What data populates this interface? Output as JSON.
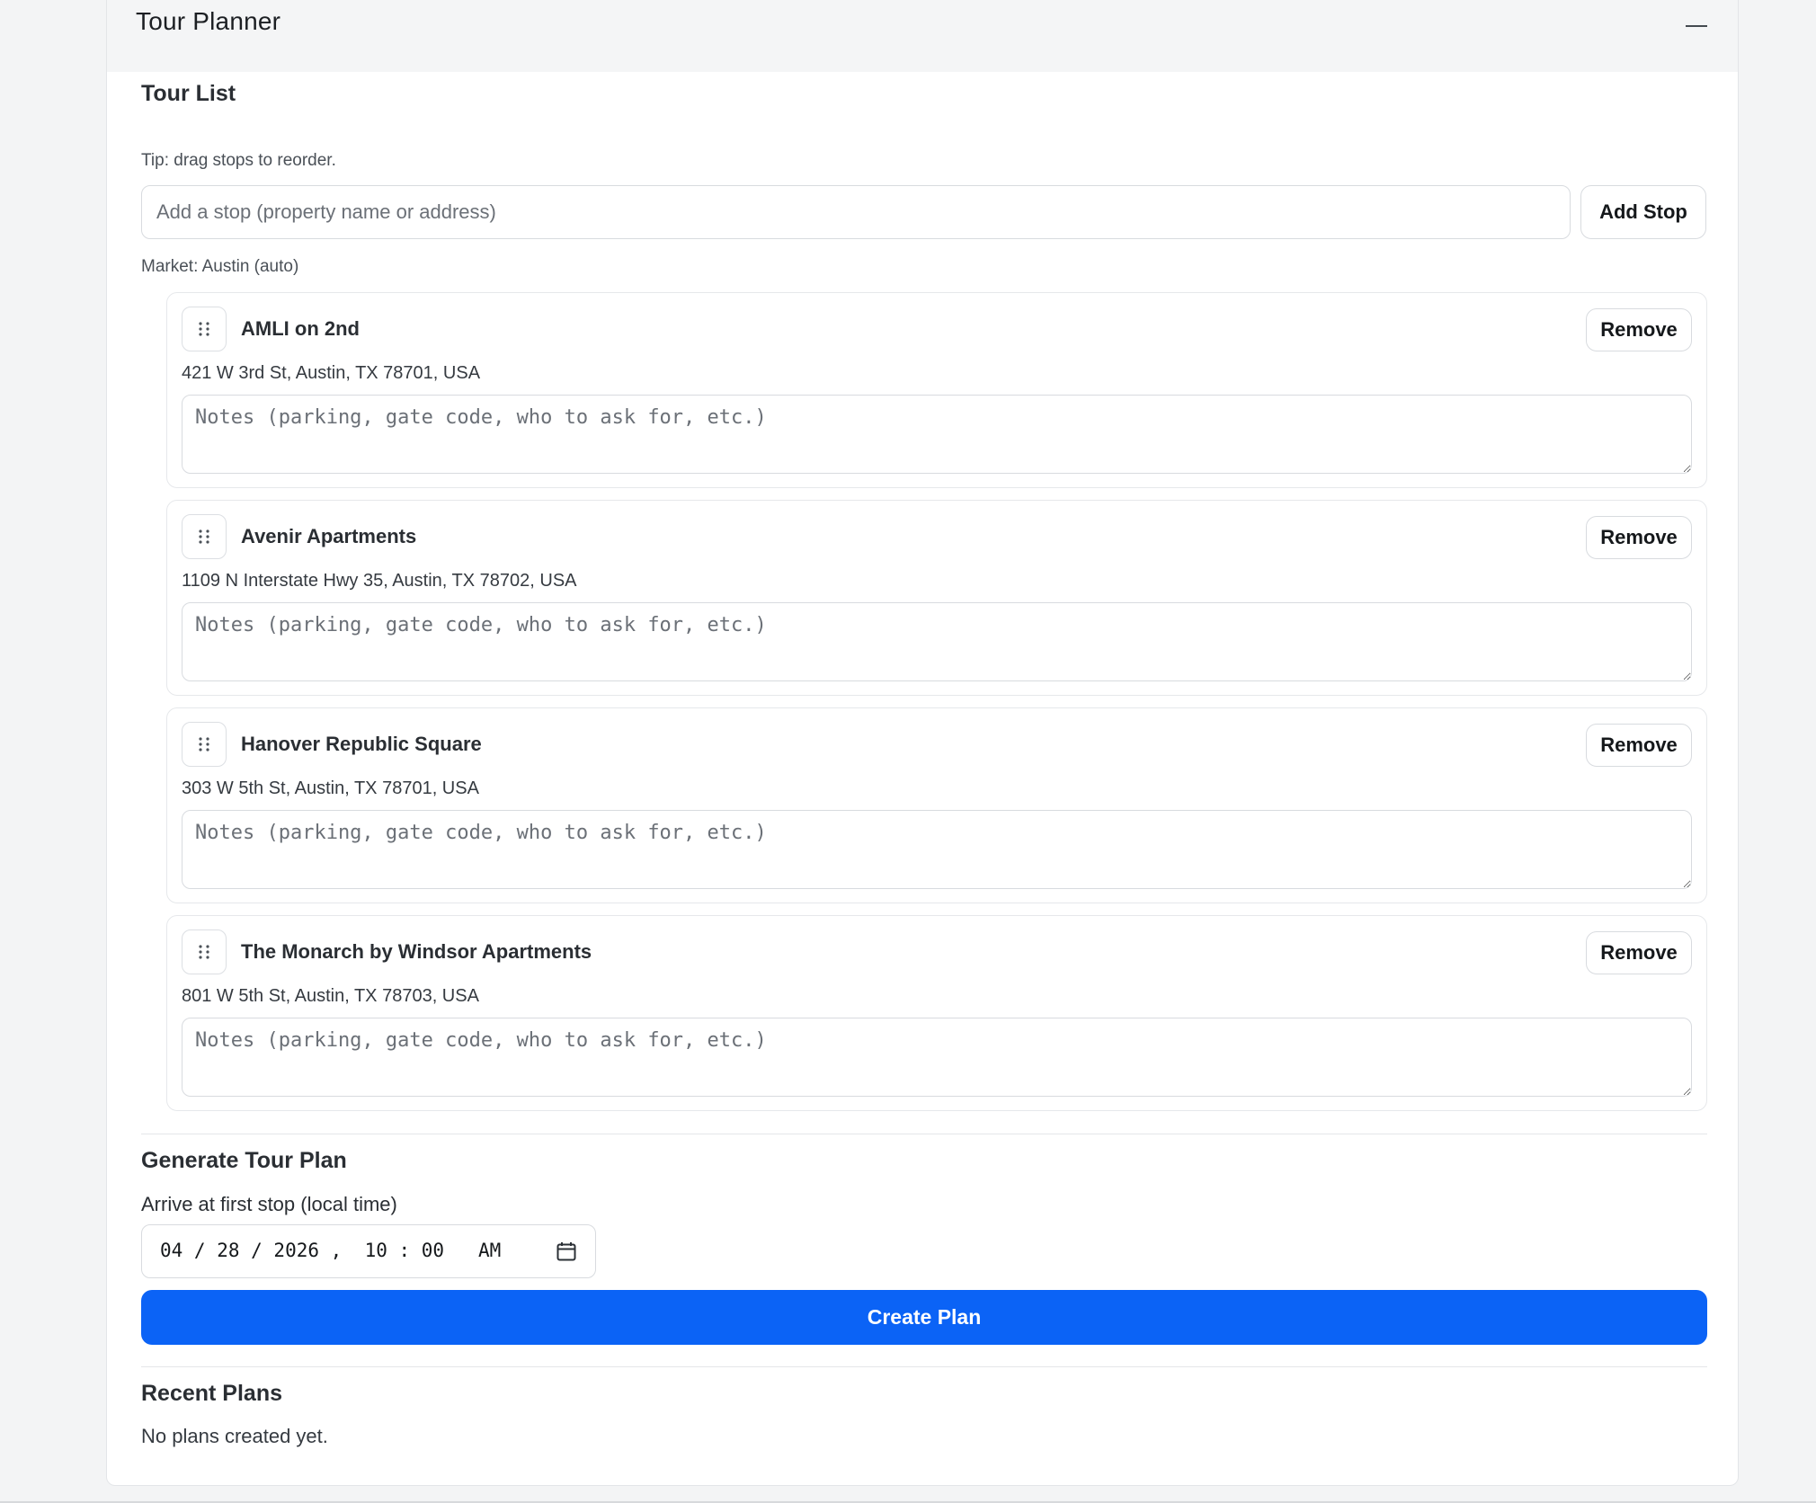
{
  "panel": {
    "title": "Tour Planner",
    "collapse_icon": "minus-icon"
  },
  "tour_list": {
    "heading": "Tour List",
    "tip": "Tip: drag stops to reorder.",
    "add_stop": {
      "placeholder": "Add a stop (property name or address)",
      "value": "",
      "button_label": "Add Stop"
    },
    "market": "Market: Austin (auto)",
    "stops": [
      {
        "name": "AMLI on 2nd",
        "address": "421 W 3rd St, Austin, TX 78701, USA",
        "notes_placeholder": "Notes (parking, gate code, who to ask for, etc.)",
        "notes_value": "",
        "remove_label": "Remove"
      },
      {
        "name": "Avenir Apartments",
        "address": "1109 N Interstate Hwy 35, Austin, TX 78702, USA",
        "notes_placeholder": "Notes (parking, gate code, who to ask for, etc.)",
        "notes_value": "",
        "remove_label": "Remove"
      },
      {
        "name": "Hanover Republic Square",
        "address": "303 W 5th St, Austin, TX 78701, USA",
        "notes_placeholder": "Notes (parking, gate code, who to ask for, etc.)",
        "notes_value": "",
        "remove_label": "Remove"
      },
      {
        "name": "The Monarch by Windsor Apartments",
        "address": "801 W 5th St, Austin, TX 78703, USA",
        "notes_placeholder": "Notes (parking, gate code, who to ask for, etc.)",
        "notes_value": "",
        "remove_label": "Remove"
      }
    ]
  },
  "generate": {
    "heading": "Generate Tour Plan",
    "arrive_label": "Arrive at first stop (local time)",
    "datetime_display": "04 / 28 / 2026 ,  10 : 00   AM",
    "calendar_icon": "calendar-icon",
    "create_label": "Create Plan",
    "create_color": "#0b63f6"
  },
  "recent": {
    "heading": "Recent Plans",
    "empty_text": "No plans created yet."
  }
}
